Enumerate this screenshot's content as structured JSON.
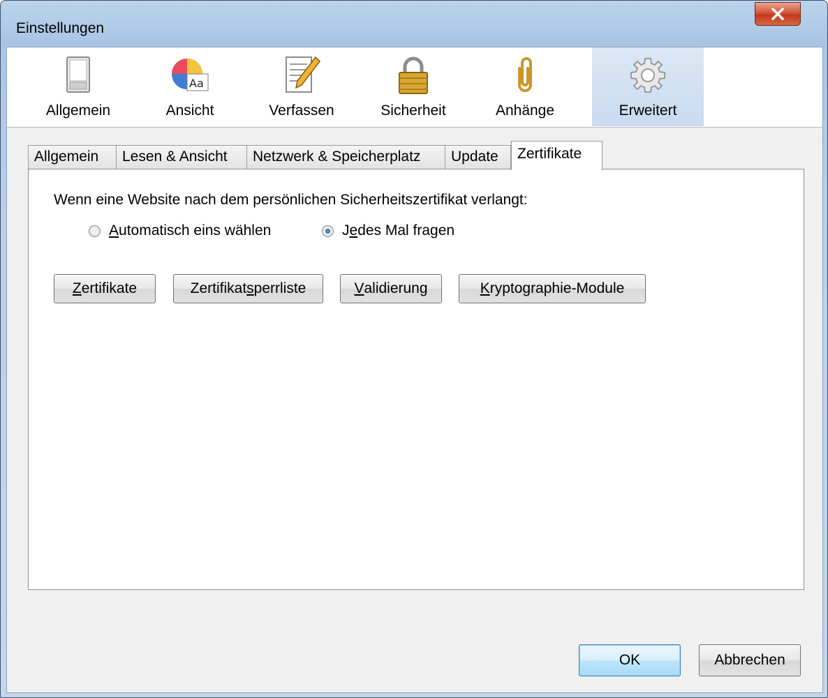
{
  "window": {
    "title": "Einstellungen"
  },
  "panes": [
    {
      "label": "Allgemein"
    },
    {
      "label": "Ansicht"
    },
    {
      "label": "Verfassen"
    },
    {
      "label": "Sicherheit"
    },
    {
      "label": "Anhänge"
    },
    {
      "label": "Erweitert",
      "selected": true
    }
  ],
  "subtabs": [
    {
      "label": "Allgemein"
    },
    {
      "label": "Lesen & Ansicht"
    },
    {
      "label": "Netzwerk & Speicherplatz"
    },
    {
      "label": "Update"
    },
    {
      "label": "Zertifikate",
      "active": true
    }
  ],
  "certificates": {
    "prompt": "Wenn eine Website nach dem persönlichen Sicherheitszertifikat verlangt:",
    "radio_auto": {
      "pre": "",
      "key": "A",
      "post": "utomatisch eins wählen",
      "checked": false
    },
    "radio_ask": {
      "pre": "J",
      "key": "e",
      "post": "des Mal fragen",
      "checked": true
    },
    "buttons": {
      "certs": {
        "pre": "",
        "key": "Z",
        "post": "ertifikate"
      },
      "crl": {
        "pre": "Zertifikat",
        "key": "s",
        "post": "perrliste"
      },
      "validation": {
        "pre": "",
        "key": "V",
        "post": "alidierung"
      },
      "crypto": {
        "pre": "",
        "key": "K",
        "post": "ryptographie-Module"
      }
    }
  },
  "footer": {
    "ok": "OK",
    "cancel": "Abbrechen"
  },
  "colors": {
    "accent": "#3c7fb1",
    "close": "#c23a1e"
  }
}
